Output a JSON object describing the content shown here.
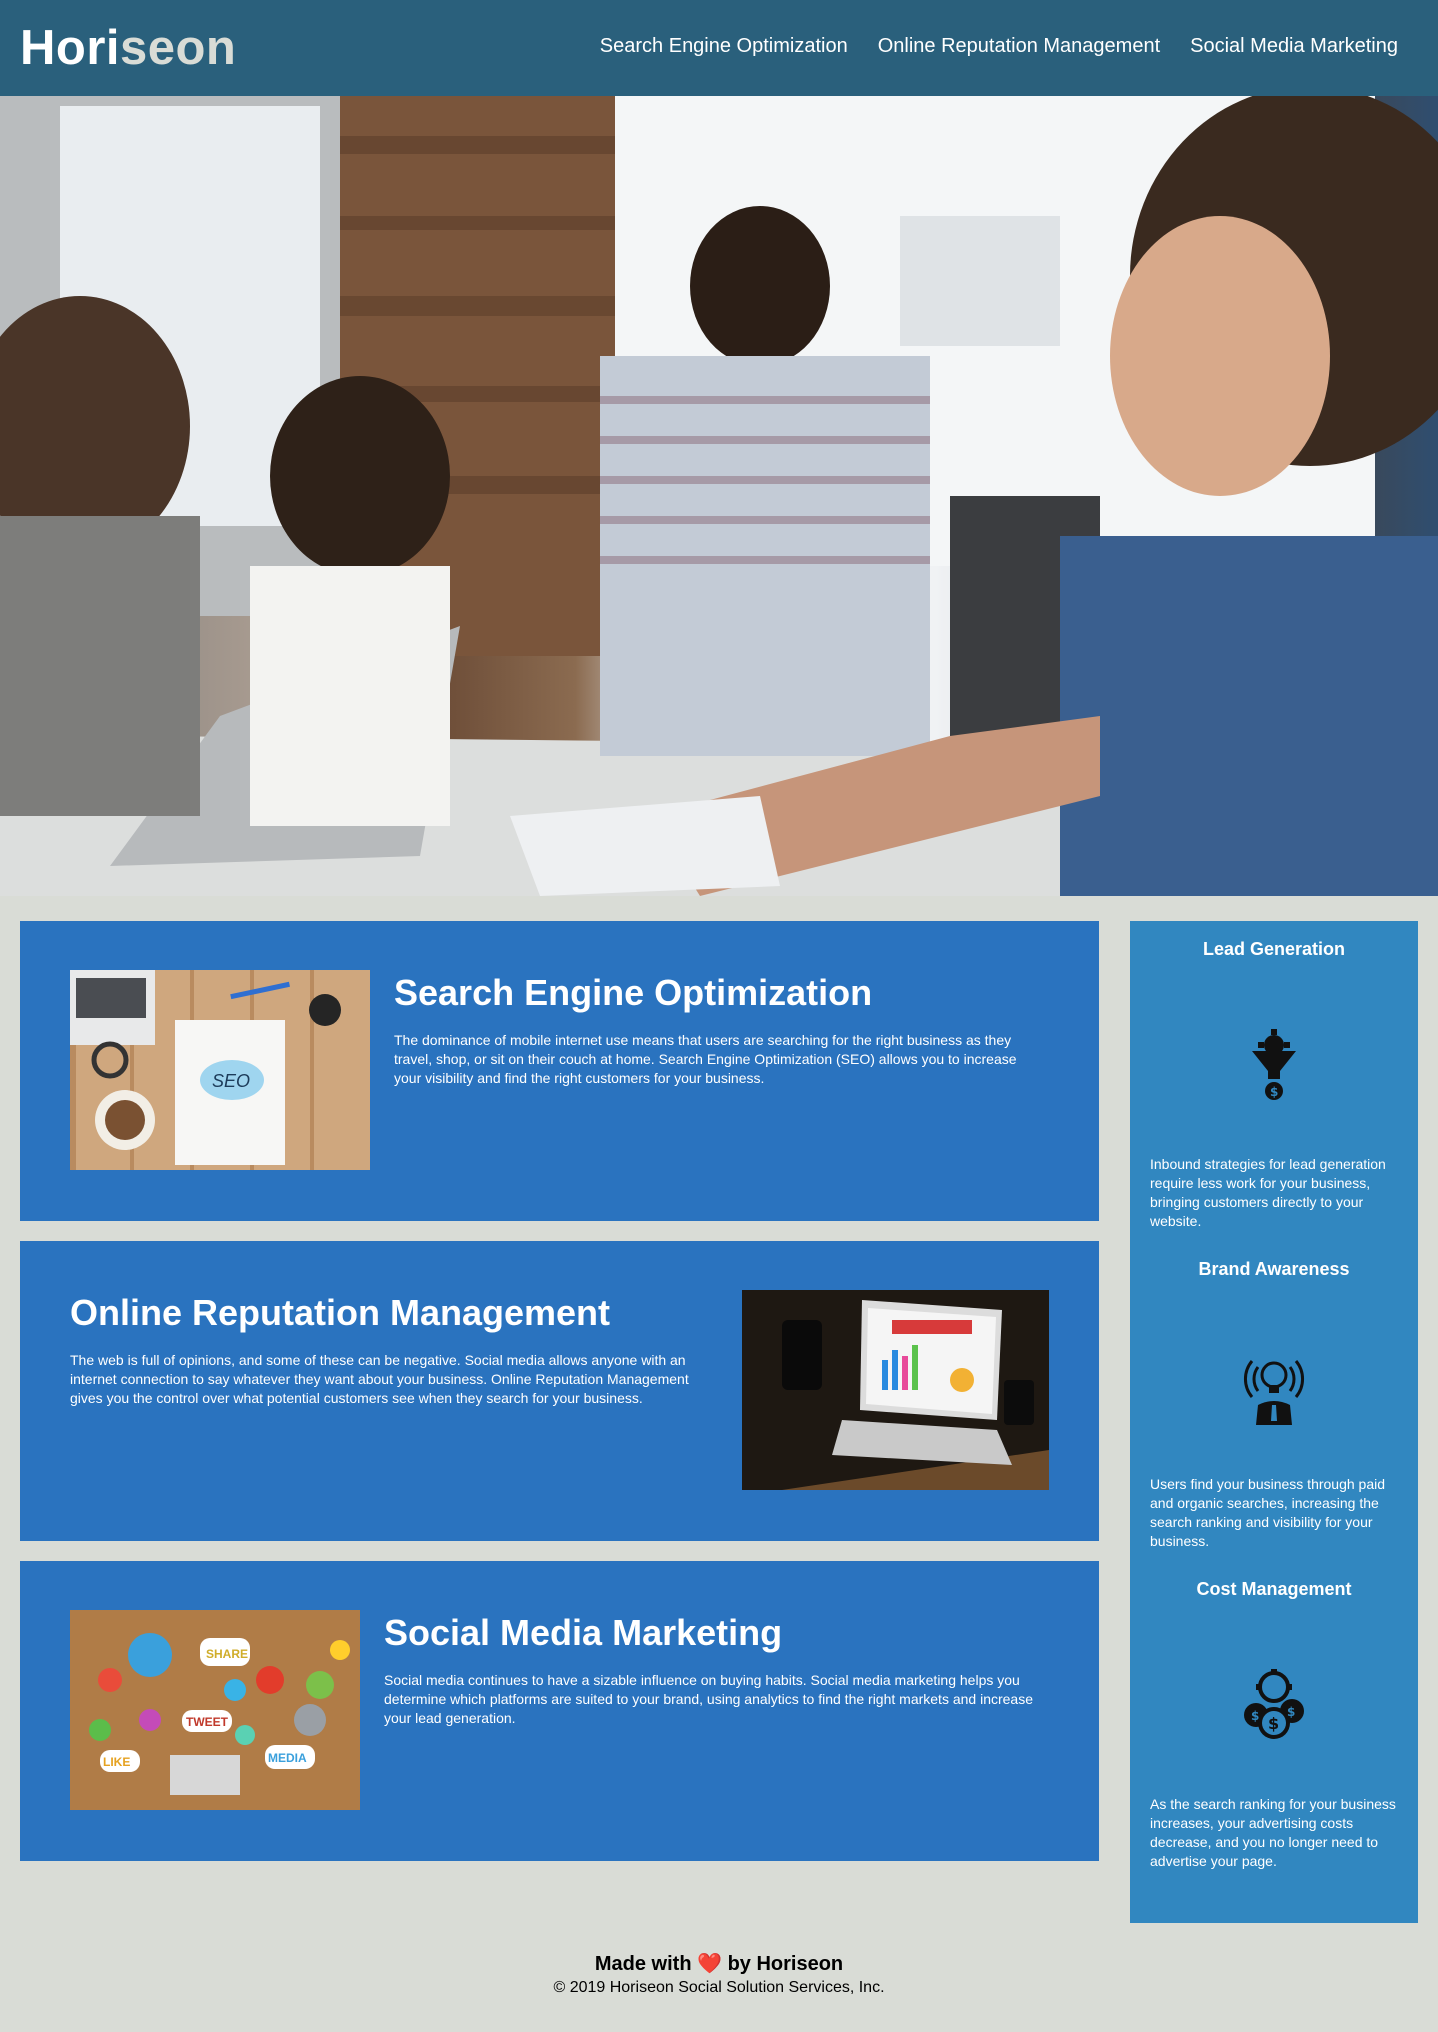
{
  "header": {
    "logo_main": "Hori",
    "logo_accent": "seon",
    "nav": [
      {
        "label": "Search Engine Optimization"
      },
      {
        "label": "Online Reputation Management"
      },
      {
        "label": "Social Media Marketing"
      }
    ]
  },
  "hero": {
    "image": "team-meeting-photo"
  },
  "content": [
    {
      "id": "search-engine-optimization",
      "title": "Search Engine Optimization",
      "text": "The dominance of mobile internet use means that users are searching for the right business as they travel, shop, or sit on their couch at home. Search Engine Optimization (SEO) allows you to increase your visibility and find the right customers for your business.",
      "image": "seo-notebook-photo"
    },
    {
      "id": "online-reputation-management",
      "title": "Online Reputation Management",
      "text": "The web is full of opinions, and some of these can be negative. Social media allows anyone with an internet connection to say whatever they want about your business. Online Reputation Management gives you the control over what potential customers see when they search for your business.",
      "image": "reputation-laptop-photo"
    },
    {
      "id": "social-media-marketing",
      "title": "Social Media Marketing",
      "text": "Social media continues to have a sizable influence on buying habits. Social media marketing helps you determine which platforms are suited to your brand, using analytics to find the right markets and increase your lead generation.",
      "image": "social-media-icons-photo"
    }
  ],
  "benefits": [
    {
      "title": "Lead Generation",
      "icon": "lead-funnel-icon",
      "text": "Inbound strategies for lead generation require less work for your business, bringing customers directly to your website."
    },
    {
      "title": "Brand Awareness",
      "icon": "brand-lightbulb-icon",
      "text": "Users find your business through paid and organic searches, increasing the search ranking and visibility for your business."
    },
    {
      "title": "Cost Management",
      "icon": "cost-coins-icon",
      "text": "As the search ranking for your business increases, your advertising costs decrease, and you no longer need to advertise your page."
    }
  ],
  "footer": {
    "made_prefix": "Made with",
    "heart": "❤️",
    "made_suffix": "by Horiseon",
    "copyright": "© 2019 Horiseon Social Solution Services, Inc."
  },
  "colors": {
    "header_bg": "#2a607c",
    "page_bg": "#d9dcd6",
    "card_bg": "#2a73bf",
    "sidebar_bg": "#3187c0",
    "logo_accent": "#d9dcd6"
  }
}
